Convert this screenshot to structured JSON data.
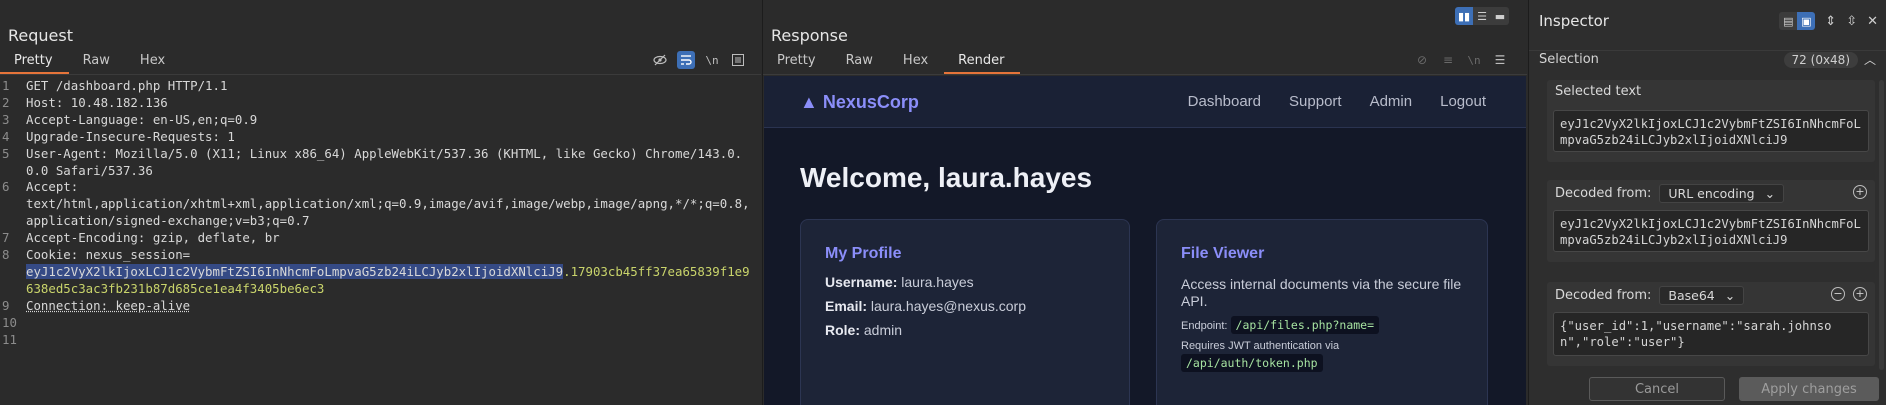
{
  "request": {
    "title": "Request",
    "tabs": [
      "Pretty",
      "Raw",
      "Hex"
    ],
    "active_tab": "Pretty",
    "lines": [
      {
        "n": "1",
        "parts": [
          {
            "t": "GET /dashboard.php HTTP/1.1"
          }
        ]
      },
      {
        "n": "2",
        "parts": [
          {
            "t": "Host: 10.48.182.136"
          }
        ]
      },
      {
        "n": "3",
        "parts": [
          {
            "t": "Accept-Language: en-US,en;q=0.9"
          }
        ]
      },
      {
        "n": "4",
        "parts": [
          {
            "t": "Upgrade-Insecure-Requests: 1"
          }
        ]
      },
      {
        "n": "5",
        "parts": [
          {
            "t": "User-Agent: Mozilla/5.0 (X11; Linux x86_64) AppleWebKit/537.36 (KHTML, like Gecko) Chrome/143.0.0.0 Safari/537.36"
          }
        ]
      },
      {
        "n": "6",
        "parts": [
          {
            "t": "Accept:\ntext/html,application/xhtml+xml,application/xml;q=0.9,image/avif,image/webp,image/apng,*/*;q=0.8,application/signed-exchange;v=b3;q=0.7"
          }
        ]
      },
      {
        "n": "7",
        "parts": [
          {
            "t": "Accept-Encoding: gzip, deflate, br"
          }
        ]
      },
      {
        "n": "8",
        "parts": [
          {
            "t": "Cookie: nexus_session=\n"
          },
          {
            "t": "eyJ1c2VyX2lkIjoxLCJ1c2VybmFtZSI6InNhcmFoLmpvaG5zb24iLCJyb2xlIjoidXNlciJ9",
            "cls": "hl"
          },
          {
            "t": ".17903cb45ff37ea65839f1e9638ed5c3ac3fb231b87d685ce1ea4f3405be6ec3",
            "cls": "sig"
          }
        ]
      },
      {
        "n": "9",
        "parts": [
          {
            "t": "Connection: keep-alive",
            "cls": "ul"
          }
        ]
      },
      {
        "n": "10",
        "parts": [
          {
            "t": ""
          }
        ]
      },
      {
        "n": "11",
        "parts": [
          {
            "t": ""
          }
        ]
      }
    ]
  },
  "response": {
    "title": "Response",
    "tabs": [
      "Pretty",
      "Raw",
      "Hex",
      "Render"
    ],
    "active_tab": "Render",
    "render": {
      "brand": "▲ NexusCorp",
      "nav": [
        "Dashboard",
        "Support",
        "Admin",
        "Logout"
      ],
      "welcome": "Welcome, laura.hayes",
      "profile": {
        "title": "My Profile",
        "username_label": "Username:",
        "username": "laura.hayes",
        "email_label": "Email:",
        "email": "laura.hayes@nexus.corp",
        "role_label": "Role:",
        "role": "admin"
      },
      "viewer": {
        "title": "File Viewer",
        "desc": "Access internal documents via the secure file API.",
        "endpoint_label": "Endpoint:",
        "endpoint": "/api/files.php?name=",
        "jwt_label": "Requires JWT authentication via",
        "jwt_path": "/api/auth/token.php"
      }
    }
  },
  "inspector": {
    "title": "Inspector",
    "selection_label": "Selection",
    "selection_badge": "72 (0x48)",
    "selected_text_label": "Selected text",
    "selected_text": "eyJ1c2VyX2lkIjoxLCJ1c2VybmFtZSI6InNhcmFoLmpvaG5zb24iLCJyb2xlIjoidXNlciJ9",
    "decoded1_label": "Decoded from:",
    "decoded1_type": "URL encoding",
    "decoded1_value": "eyJ1c2VyX2lkIjoxLCJ1c2VybmFtZSI6InNhcmFoLmpvaG5zb24iLCJyb2xlIjoidXNlciJ9",
    "decoded2_label": "Decoded from:",
    "decoded2_type": "Base64",
    "decoded2_value": "{\"user_id\":1,\"username\":\"sarah.johnson\",\"role\":\"user\"}",
    "cancel": "Cancel",
    "apply": "Apply changes"
  },
  "colors": {
    "accent": "#e5743a",
    "active_toggle": "#3d6fb6",
    "selection": "#354a85",
    "brand": "#8b8ef9"
  }
}
